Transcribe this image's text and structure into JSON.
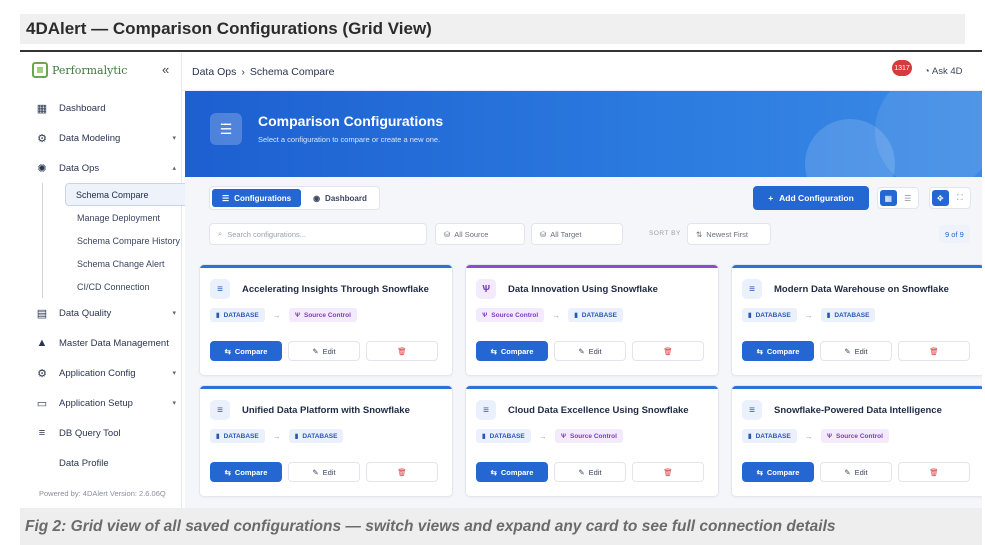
{
  "doc": {
    "title": "4DAlert — Comparison Configurations (Grid View)",
    "caption": "Fig 2: Grid view of all saved configurations — switch views and expand any card to see full connection details"
  },
  "sidebar": {
    "brand": "Performalytic",
    "collapse_glyph": "«",
    "items": [
      {
        "label": "Dashboard",
        "icon": "▦",
        "caret": ""
      },
      {
        "label": "Data Modeling",
        "icon": "⚙",
        "caret": "▾"
      },
      {
        "label": "Data Ops",
        "icon": "✺",
        "caret": "▴"
      }
    ],
    "subitems": [
      {
        "label": "Schema Compare"
      },
      {
        "label": "Manage Deployment"
      },
      {
        "label": "Schema Compare History"
      },
      {
        "label": "Schema Change Alert"
      },
      {
        "label": "CI/CD Connection"
      }
    ],
    "items_after": [
      {
        "label": "Data Quality",
        "icon": "▤",
        "caret": "▾"
      },
      {
        "label": "Master Data Management",
        "icon": "▲",
        "caret": ""
      },
      {
        "label": "Application Config",
        "icon": "⚙",
        "caret": "▾"
      },
      {
        "label": "Application Setup",
        "icon": "▭",
        "caret": "▾"
      },
      {
        "label": "DB Query Tool",
        "icon": "≡",
        "caret": ""
      },
      {
        "label": "Data Profile",
        "icon": "",
        "caret": ""
      }
    ],
    "powered": "Powered by: 4DAlert  Version: 2.6.06Q"
  },
  "topbar": {
    "crumb_root": "Data Ops",
    "crumb_sep": "›",
    "crumb_page": "Schema Compare",
    "notif_count": "1317",
    "ask_label": "Ask 4D"
  },
  "hero": {
    "icon": "☰",
    "title": "Comparison Configurations",
    "subtitle": "Select a configuration to compare or create a new one."
  },
  "tabs": [
    {
      "label": "Configurations",
      "icon": "☰"
    },
    {
      "label": "Dashboard",
      "icon": "◉"
    }
  ],
  "add_button": {
    "label": "Add Configuration",
    "icon": "+"
  },
  "filters": {
    "search_placeholder": "Search configurations...",
    "source": "All Source",
    "target": "All Target",
    "sort_label": "SORT BY",
    "sort_value": "Newest First",
    "count": "9 of 9"
  },
  "cards": [
    {
      "title": "Accelerating Insights Through Snowflake",
      "type": "db",
      "source": "DATABASE",
      "target": "Source Control"
    },
    {
      "title": "Data Innovation Using Snowflake",
      "type": "sc",
      "source": "Source Control",
      "target": "DATABASE"
    },
    {
      "title": "Modern Data Warehouse on Snowflake",
      "type": "db",
      "source": "DATABASE",
      "target": "DATABASE"
    },
    {
      "title": "Unified Data Platform with Snowflake",
      "type": "db",
      "source": "DATABASE",
      "target": "DATABASE"
    },
    {
      "title": "Cloud Data Excellence Using Snowflake",
      "type": "db",
      "source": "DATABASE",
      "target": "Source Control"
    },
    {
      "title": "Snowflake-Powered Data Intelligence",
      "type": "db",
      "source": "DATABASE",
      "target": "Source Control"
    }
  ],
  "card_actions": {
    "compare": "Compare",
    "edit": "Edit",
    "delete_icon": "🗑"
  },
  "colors": {
    "accent": "#2467d3",
    "source_control": "#7d3cc2",
    "danger": "#d63a3a"
  }
}
